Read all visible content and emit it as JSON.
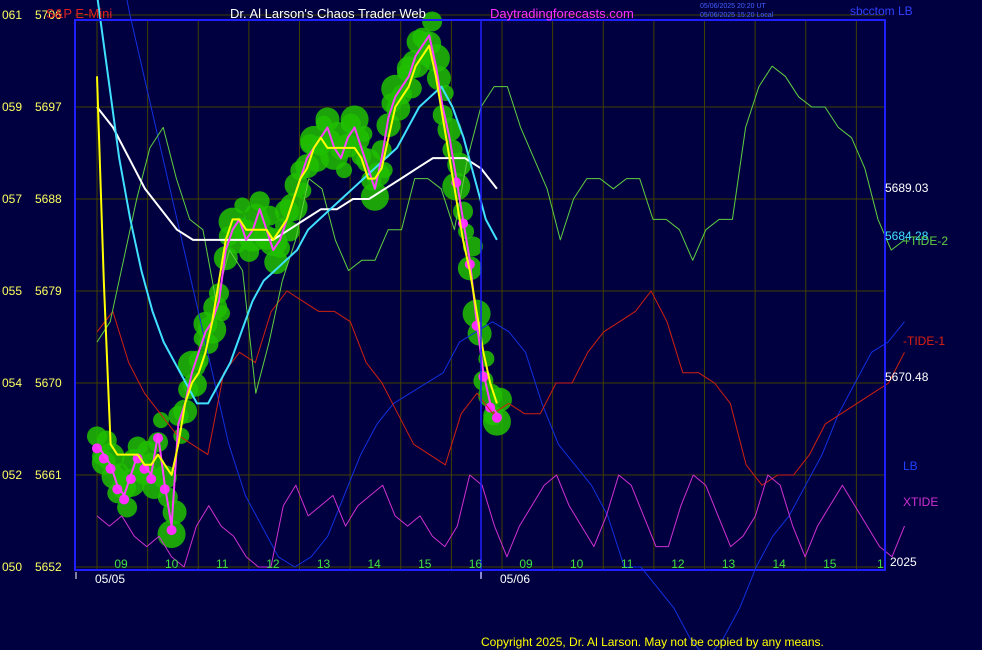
{
  "header": {
    "symbol": "S&P E-Mini",
    "title": "Dr. Al Larson's Chaos Trader Web",
    "site": "Daytradingforecasts.com",
    "stamp_ut": "05/06/2025 20:20 UT",
    "stamp_local": "05/06/2025 15:20 Local",
    "corner_label": "sbcctom LB"
  },
  "footer": {
    "copyright": "Copyright 2025, Dr. Al Larson. May not be copied by any means.",
    "year": "2025"
  },
  "colors": {
    "background": "#000040",
    "grid": "#404000",
    "frame": "#2020ff",
    "price": "#ff40ff",
    "fast_avg": "#ffff00",
    "mid_avg": "#40e0ff",
    "slow_avg": "#ffffff",
    "tide2": "#60d040",
    "tide1": "#d02010",
    "lb": "#1030e0",
    "xtide": "#d030d0",
    "ball_green": "#20c000",
    "ball_magenta": "#ff30ff"
  },
  "chart_data": {
    "type": "line",
    "y_axis": {
      "left_labels": [
        "061",
        "059",
        "057",
        "055",
        "054",
        "052",
        "050"
      ],
      "price_labels": [
        "5706",
        "5697",
        "5688",
        "5679",
        "5670",
        "5661",
        "5652"
      ],
      "range": [
        5652,
        5706
      ]
    },
    "x_axis": {
      "ticks": [
        "09",
        "10",
        "11",
        "12",
        "13",
        "14",
        "15",
        "16",
        "09",
        "10",
        "11",
        "12",
        "13",
        "14",
        "15",
        "1"
      ],
      "dates": [
        "05/05",
        "05/06"
      ]
    },
    "right_labels": {
      "price1": "5689.03",
      "price2": "5684.28",
      "tide2": "+TIDE-2",
      "tide1": "-TIDE-1",
      "price3": "5670.48",
      "lb": "LB",
      "xtide": "XTIDE"
    },
    "series": [
      {
        "key": "price",
        "color": "#ff40ff",
        "y": [
          5664,
          5663,
          5662,
          5660,
          5659,
          5661,
          5663,
          5662,
          5661,
          5665,
          5660,
          5656,
          5666,
          5668,
          5671,
          5673,
          5675,
          5676,
          5678,
          5683,
          5685,
          5686,
          5684,
          5685,
          5687,
          5685,
          5683,
          5684,
          5686,
          5688,
          5690,
          5692,
          5693,
          5694,
          5695,
          5693,
          5692,
          5694,
          5695,
          5693,
          5691,
          5689,
          5692,
          5696,
          5698,
          5699,
          5700,
          5702,
          5703,
          5704,
          5701,
          5697,
          5694,
          5690,
          5686,
          5682,
          5676,
          5671,
          5668,
          5667
        ],
        "x0": 0.0,
        "x1": 7.9
      },
      {
        "key": "fast_avg",
        "color": "#ffff00",
        "y": [
          5700,
          5680,
          5664,
          5663,
          5663,
          5663,
          5663,
          5662,
          5662,
          5663,
          5662,
          5661,
          5664,
          5668,
          5670,
          5671,
          5673,
          5676,
          5680,
          5684,
          5686,
          5686,
          5685,
          5685,
          5685,
          5685,
          5684,
          5685,
          5686,
          5688,
          5690,
          5691,
          5693,
          5694,
          5693,
          5693,
          5693,
          5693,
          5693,
          5692,
          5690,
          5690,
          5691,
          5694,
          5697,
          5698,
          5699,
          5701,
          5702,
          5703,
          5700,
          5696,
          5692,
          5688,
          5684,
          5681,
          5677,
          5673,
          5670,
          5668
        ],
        "x0": 0.0,
        "x1": 7.9
      },
      {
        "key": "mid_avg",
        "color": "#40e0ff",
        "y": [
          5708,
          5700,
          5692,
          5686,
          5681,
          5677,
          5674,
          5672,
          5670,
          5668,
          5668,
          5670,
          5672,
          5675,
          5678,
          5680,
          5681,
          5682,
          5683,
          5685,
          5686,
          5687,
          5688,
          5689,
          5690,
          5691,
          5692,
          5693,
          5695,
          5697,
          5698,
          5699,
          5697,
          5694,
          5690,
          5686,
          5684
        ],
        "x0": 0.0,
        "x1": 7.9
      },
      {
        "key": "slow_avg",
        "color": "#ffffff",
        "y": [
          5697,
          5695,
          5692,
          5689,
          5687,
          5685,
          5684,
          5684,
          5684,
          5684,
          5684,
          5684,
          5685,
          5686,
          5687,
          5687,
          5688,
          5688,
          5689,
          5690,
          5691,
          5692,
          5692,
          5692,
          5691,
          5689
        ],
        "x0": 0.0,
        "x1": 7.9
      },
      {
        "key": "tide2",
        "color": "#60d040",
        "y": [
          5674,
          5676,
          5682,
          5688,
          5693,
          5695,
          5690,
          5686,
          5685,
          5678,
          5683,
          5681,
          5669,
          5674,
          5680,
          5684,
          5690,
          5689,
          5684,
          5681,
          5682,
          5682,
          5685,
          5685,
          5690,
          5690,
          5689,
          5685,
          5692,
          5697,
          5699,
          5699,
          5695,
          5692,
          5689,
          5684,
          5688,
          5690,
          5690,
          5689,
          5690,
          5690,
          5686,
          5686,
          5685,
          5682,
          5685,
          5686,
          5686,
          5695,
          5699,
          5701,
          5700,
          5698,
          5697,
          5697,
          5695,
          5694,
          5691,
          5686,
          5683,
          5684
        ],
        "x0": 0.0,
        "x1": 15.95
      },
      {
        "key": "tide1",
        "color": "#d02010",
        "y": [
          5675,
          5677,
          5672,
          5669,
          5667,
          5665,
          5664,
          5663,
          5671,
          5673,
          5672,
          5677,
          5679,
          5678,
          5677,
          5677,
          5676,
          5672,
          5670,
          5667,
          5664,
          5663,
          5662,
          5667,
          5669,
          5667,
          5668,
          5667,
          5667,
          5670,
          5670,
          5673,
          5675,
          5676,
          5677,
          5679,
          5676,
          5671,
          5671,
          5670,
          5668,
          5662,
          5660,
          5661,
          5661,
          5663,
          5666,
          5667,
          5668,
          5669,
          5670,
          5673
        ],
        "x0": 0.0,
        "x1": 15.95
      },
      {
        "key": "lb",
        "color": "#1030e0",
        "y": [
          5720,
          5714,
          5706,
          5699,
          5692,
          5685,
          5678,
          5671,
          5664,
          5659,
          5656,
          5653,
          5652,
          5653,
          5655,
          5659,
          5663,
          5666,
          5668,
          5669,
          5670,
          5671,
          5674,
          5675,
          5676,
          5675,
          5673,
          5668,
          5664,
          5662,
          5660,
          5657,
          5652,
          5652,
          5650,
          5648,
          5645,
          5643,
          5645,
          5648,
          5652,
          5655,
          5657,
          5660,
          5663,
          5667,
          5670,
          5673,
          5674,
          5676
        ],
        "x0": 0.0,
        "x1": 15.95
      },
      {
        "key": "xtide",
        "color": "#d030d0",
        "y": [
          5657,
          5656,
          5657,
          5655,
          5654,
          5655,
          5653,
          5652,
          5656,
          5658,
          5656,
          5655,
          5653,
          5652,
          5652,
          5658,
          5660,
          5657,
          5658,
          5659,
          5656,
          5658,
          5659,
          5660,
          5657,
          5656,
          5657,
          5655,
          5654,
          5656,
          5661,
          5660,
          5656,
          5653,
          5656,
          5658,
          5660,
          5661,
          5658,
          5656,
          5654,
          5657,
          5661,
          5660,
          5657,
          5654,
          5654,
          5658,
          5661,
          5660,
          5657,
          5654,
          5655,
          5657,
          5661,
          5660,
          5656,
          5653,
          5656,
          5658,
          5660,
          5658,
          5656,
          5654,
          5653,
          5656
        ],
        "x0": 0.0,
        "x1": 15.95
      }
    ]
  }
}
